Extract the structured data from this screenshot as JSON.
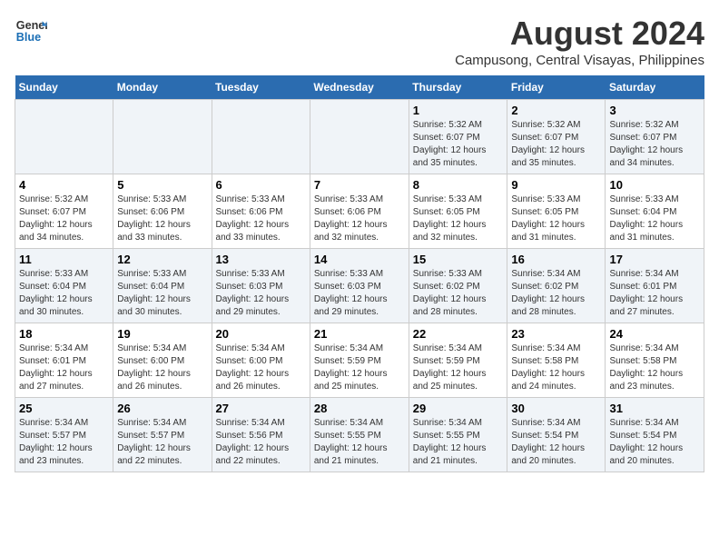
{
  "logo": {
    "line1": "General",
    "line2": "Blue"
  },
  "title": "August 2024",
  "subtitle": "Campusong, Central Visayas, Philippines",
  "days_of_week": [
    "Sunday",
    "Monday",
    "Tuesday",
    "Wednesday",
    "Thursday",
    "Friday",
    "Saturday"
  ],
  "weeks": [
    [
      {
        "day": "",
        "info": ""
      },
      {
        "day": "",
        "info": ""
      },
      {
        "day": "",
        "info": ""
      },
      {
        "day": "",
        "info": ""
      },
      {
        "day": "1",
        "info": "Sunrise: 5:32 AM\nSunset: 6:07 PM\nDaylight: 12 hours\nand 35 minutes."
      },
      {
        "day": "2",
        "info": "Sunrise: 5:32 AM\nSunset: 6:07 PM\nDaylight: 12 hours\nand 35 minutes."
      },
      {
        "day": "3",
        "info": "Sunrise: 5:32 AM\nSunset: 6:07 PM\nDaylight: 12 hours\nand 34 minutes."
      }
    ],
    [
      {
        "day": "4",
        "info": "Sunrise: 5:32 AM\nSunset: 6:07 PM\nDaylight: 12 hours\nand 34 minutes."
      },
      {
        "day": "5",
        "info": "Sunrise: 5:33 AM\nSunset: 6:06 PM\nDaylight: 12 hours\nand 33 minutes."
      },
      {
        "day": "6",
        "info": "Sunrise: 5:33 AM\nSunset: 6:06 PM\nDaylight: 12 hours\nand 33 minutes."
      },
      {
        "day": "7",
        "info": "Sunrise: 5:33 AM\nSunset: 6:06 PM\nDaylight: 12 hours\nand 32 minutes."
      },
      {
        "day": "8",
        "info": "Sunrise: 5:33 AM\nSunset: 6:05 PM\nDaylight: 12 hours\nand 32 minutes."
      },
      {
        "day": "9",
        "info": "Sunrise: 5:33 AM\nSunset: 6:05 PM\nDaylight: 12 hours\nand 31 minutes."
      },
      {
        "day": "10",
        "info": "Sunrise: 5:33 AM\nSunset: 6:04 PM\nDaylight: 12 hours\nand 31 minutes."
      }
    ],
    [
      {
        "day": "11",
        "info": "Sunrise: 5:33 AM\nSunset: 6:04 PM\nDaylight: 12 hours\nand 30 minutes."
      },
      {
        "day": "12",
        "info": "Sunrise: 5:33 AM\nSunset: 6:04 PM\nDaylight: 12 hours\nand 30 minutes."
      },
      {
        "day": "13",
        "info": "Sunrise: 5:33 AM\nSunset: 6:03 PM\nDaylight: 12 hours\nand 29 minutes."
      },
      {
        "day": "14",
        "info": "Sunrise: 5:33 AM\nSunset: 6:03 PM\nDaylight: 12 hours\nand 29 minutes."
      },
      {
        "day": "15",
        "info": "Sunrise: 5:33 AM\nSunset: 6:02 PM\nDaylight: 12 hours\nand 28 minutes."
      },
      {
        "day": "16",
        "info": "Sunrise: 5:34 AM\nSunset: 6:02 PM\nDaylight: 12 hours\nand 28 minutes."
      },
      {
        "day": "17",
        "info": "Sunrise: 5:34 AM\nSunset: 6:01 PM\nDaylight: 12 hours\nand 27 minutes."
      }
    ],
    [
      {
        "day": "18",
        "info": "Sunrise: 5:34 AM\nSunset: 6:01 PM\nDaylight: 12 hours\nand 27 minutes."
      },
      {
        "day": "19",
        "info": "Sunrise: 5:34 AM\nSunset: 6:00 PM\nDaylight: 12 hours\nand 26 minutes."
      },
      {
        "day": "20",
        "info": "Sunrise: 5:34 AM\nSunset: 6:00 PM\nDaylight: 12 hours\nand 26 minutes."
      },
      {
        "day": "21",
        "info": "Sunrise: 5:34 AM\nSunset: 5:59 PM\nDaylight: 12 hours\nand 25 minutes."
      },
      {
        "day": "22",
        "info": "Sunrise: 5:34 AM\nSunset: 5:59 PM\nDaylight: 12 hours\nand 25 minutes."
      },
      {
        "day": "23",
        "info": "Sunrise: 5:34 AM\nSunset: 5:58 PM\nDaylight: 12 hours\nand 24 minutes."
      },
      {
        "day": "24",
        "info": "Sunrise: 5:34 AM\nSunset: 5:58 PM\nDaylight: 12 hours\nand 23 minutes."
      }
    ],
    [
      {
        "day": "25",
        "info": "Sunrise: 5:34 AM\nSunset: 5:57 PM\nDaylight: 12 hours\nand 23 minutes."
      },
      {
        "day": "26",
        "info": "Sunrise: 5:34 AM\nSunset: 5:57 PM\nDaylight: 12 hours\nand 22 minutes."
      },
      {
        "day": "27",
        "info": "Sunrise: 5:34 AM\nSunset: 5:56 PM\nDaylight: 12 hours\nand 22 minutes."
      },
      {
        "day": "28",
        "info": "Sunrise: 5:34 AM\nSunset: 5:55 PM\nDaylight: 12 hours\nand 21 minutes."
      },
      {
        "day": "29",
        "info": "Sunrise: 5:34 AM\nSunset: 5:55 PM\nDaylight: 12 hours\nand 21 minutes."
      },
      {
        "day": "30",
        "info": "Sunrise: 5:34 AM\nSunset: 5:54 PM\nDaylight: 12 hours\nand 20 minutes."
      },
      {
        "day": "31",
        "info": "Sunrise: 5:34 AM\nSunset: 5:54 PM\nDaylight: 12 hours\nand 20 minutes."
      }
    ]
  ]
}
